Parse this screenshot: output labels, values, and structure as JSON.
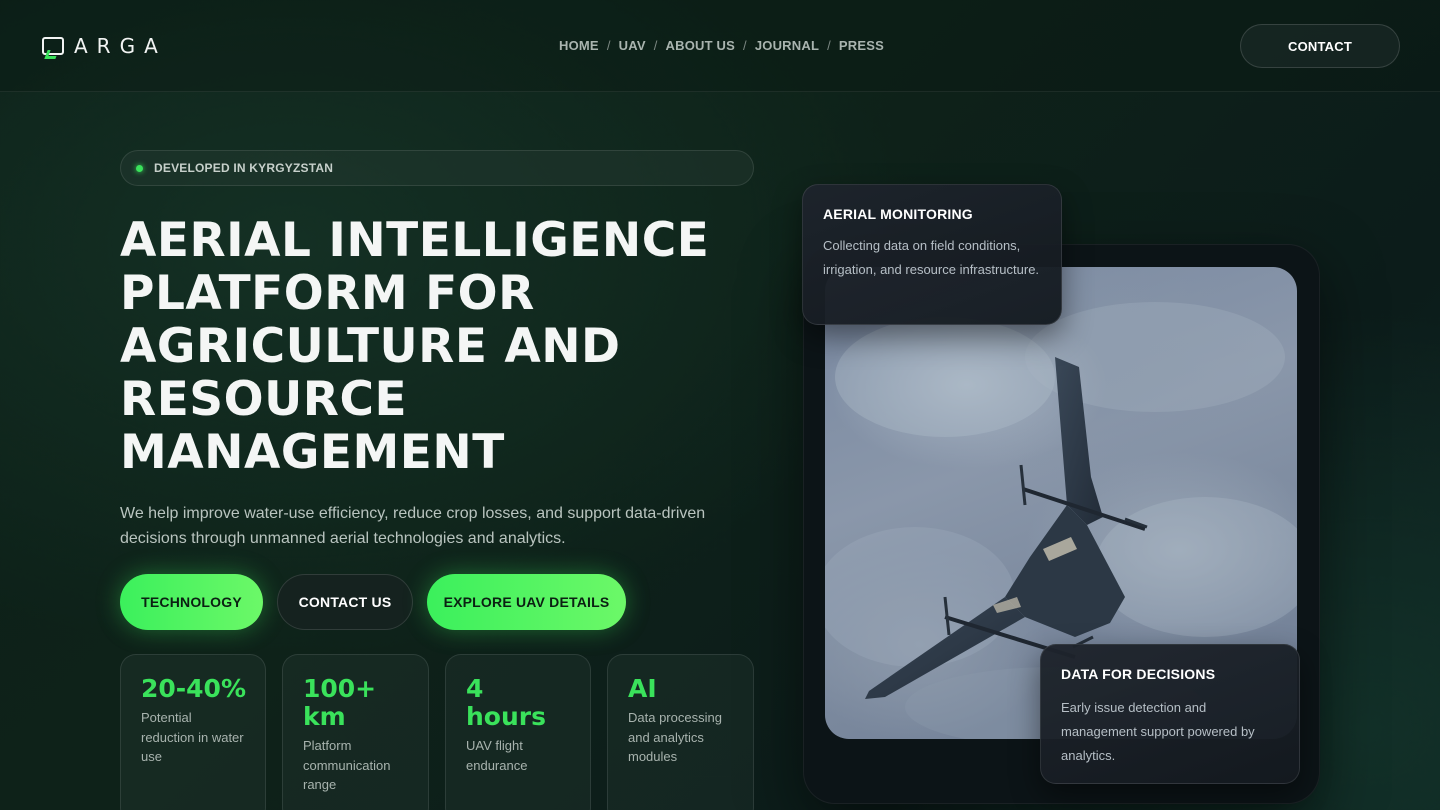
{
  "brand": {
    "name": "ARGA",
    "accent": "#3ae25b"
  },
  "nav": {
    "items": [
      "HOME",
      "UAV",
      "ABOUT US",
      "JOURNAL",
      "PRESS"
    ],
    "separator": "/",
    "contact_label": "CONTACT"
  },
  "hero": {
    "badge": "DEVELOPED IN KYRGYZSTAN",
    "title_lines": [
      "AERIAL INTELLIGENCE",
      "PLATFORM FOR",
      "AGRICULTURE AND",
      "RESOURCE",
      "MANAGEMENT"
    ],
    "description": "We help improve water-use efficiency, reduce crop losses, and support data-driven decisions through unmanned aerial technologies and analytics.",
    "buttons": {
      "technology": "TECHNOLOGY",
      "contact_us": "CONTACT US",
      "explore": "EXPLORE UAV DETAILS"
    }
  },
  "stats": [
    {
      "value": "20-40%",
      "label": "Potential reduction in water use"
    },
    {
      "value": "100+ km",
      "label": "Platform communication range"
    },
    {
      "value": "4 hours",
      "label": "UAV flight endurance"
    },
    {
      "value": "AI",
      "label": "Data processing and analytics modules"
    }
  ],
  "cards": {
    "monitoring": {
      "title": "AERIAL MONITORING",
      "text": "Collecting data on field conditions, irrigation, and resource infrastructure."
    },
    "decisions": {
      "title": "DATA FOR DECISIONS",
      "text": "Early issue detection and management support powered by analytics."
    }
  }
}
